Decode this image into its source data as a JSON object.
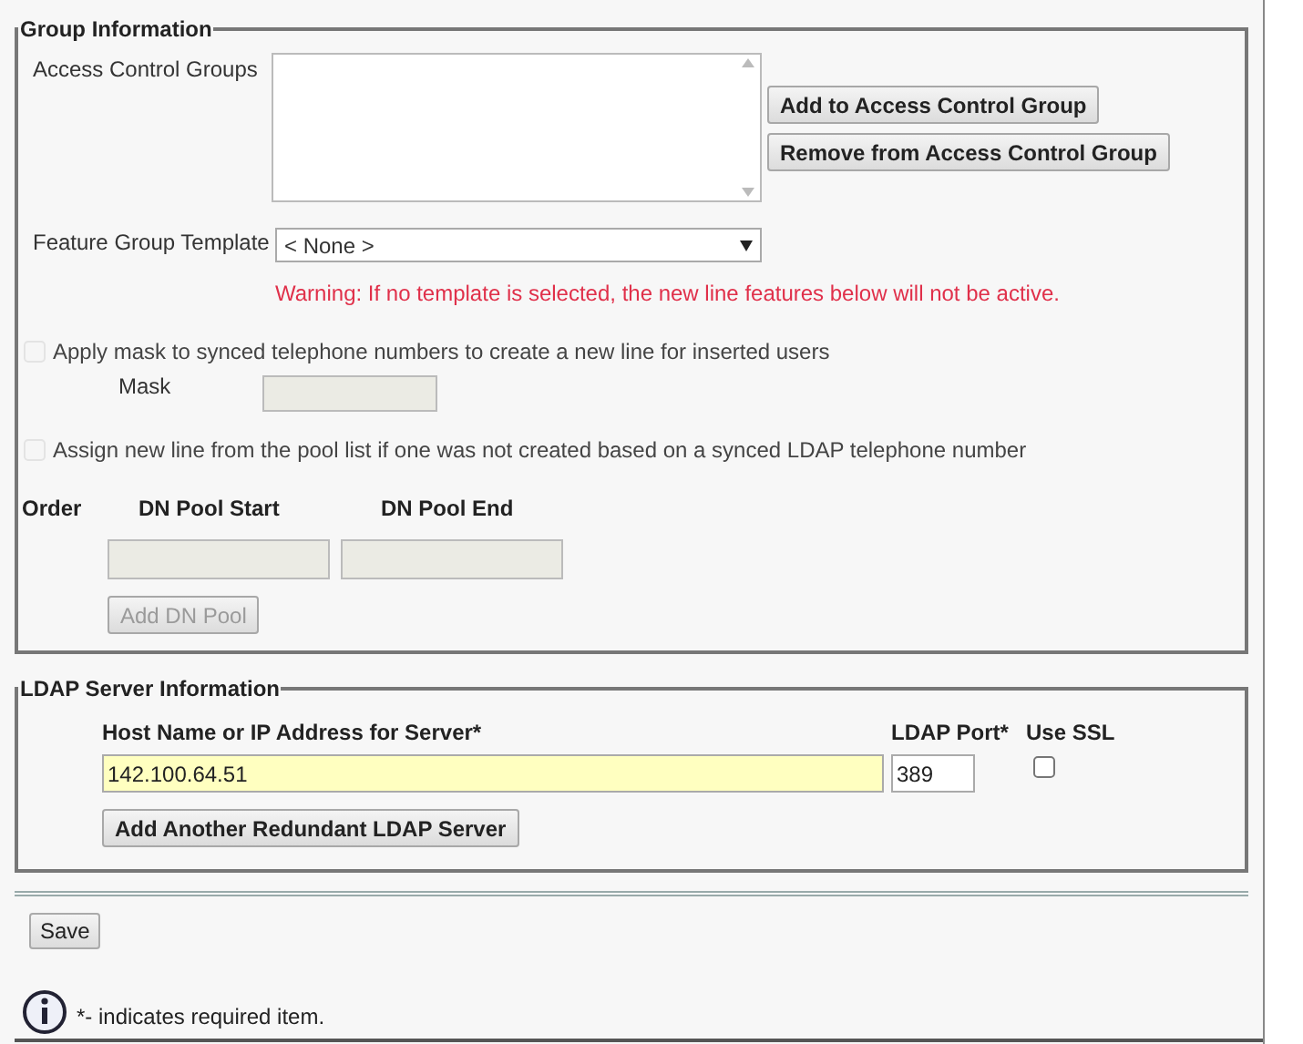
{
  "group_information": {
    "legend": "Group Information",
    "access_control_groups": {
      "label": "Access Control Groups"
    },
    "buttons": [
      "Add to Access Control Group",
      "Remove from Access Control Group"
    ],
    "feature_group_template": {
      "label": "Feature Group Template",
      "value": "< None >"
    },
    "warning": "Warning: If no template is selected, the new line features below will not be active.",
    "apply_mask": {
      "label": "Apply mask to synced telephone numbers to create a new line for inserted users",
      "checked": false,
      "disabled": true
    },
    "mask": {
      "label": "Mask",
      "disabled": true
    },
    "assign_pool": {
      "label": "Assign new line from the pool list if one was not created based on a synced LDAP telephone number",
      "checked": false,
      "disabled": true
    },
    "pool_columns": [
      "Order",
      "DN Pool Start",
      "DN Pool End"
    ],
    "add_dn_pool": {
      "label": "Add DN Pool",
      "disabled": true
    }
  },
  "ldap_server_information": {
    "legend": "LDAP Server Information",
    "host": {
      "label": "Host Name or IP Address for Server*",
      "value": "142.100.64.51"
    },
    "port": {
      "label": "LDAP Port*",
      "value": "389"
    },
    "use_ssl": {
      "label": "Use SSL",
      "checked": false
    },
    "add_button": "Add Another Redundant LDAP Server"
  },
  "save_button": "Save",
  "footer_note": "*- indicates required item."
}
